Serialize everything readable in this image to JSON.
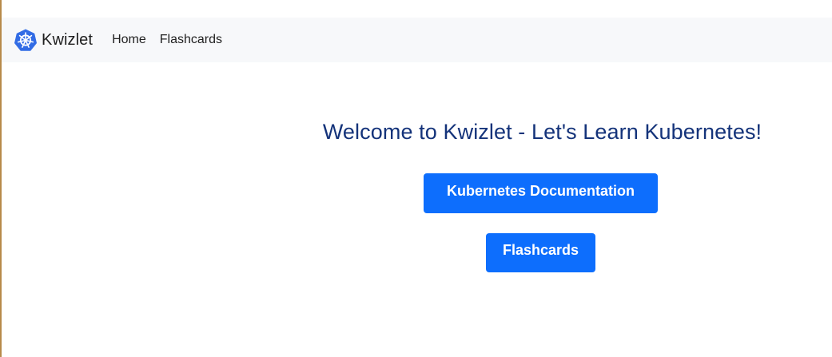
{
  "colors": {
    "navbar_bg": "#f7f8fa",
    "title_color": "#14337a",
    "button_bg": "#0d6efd",
    "button_text": "#ffffff",
    "logo_blue": "#326ce5"
  },
  "navbar": {
    "brand": {
      "icon": "kubernetes-helm-icon",
      "label": "Kwizlet"
    },
    "links": [
      {
        "label": "Home"
      },
      {
        "label": "Flashcards"
      }
    ]
  },
  "main": {
    "title": "Welcome to Kwizlet - Let's Learn Kubernetes!",
    "buttons": {
      "docs_label": "Kubernetes Documentation",
      "flashcards_label": "Flashcards"
    }
  }
}
